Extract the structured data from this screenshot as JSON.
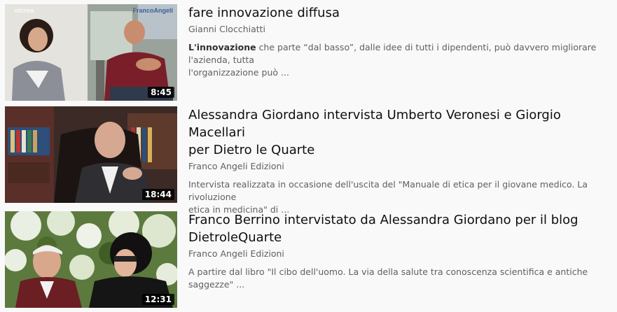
{
  "videos": [
    {
      "title_lines": [
        "fare innovazione diffusa"
      ],
      "channel": "Gianni Clocchiatti",
      "desc_bold": "L'innovazione",
      "desc_rest_line1": " che parte “dal basso”, dalle idee di tutti i dipendenti, può davvero migliorare l'azienda, tutta",
      "desc_line2": "l'organizzazione può ...",
      "duration": "8:45",
      "watermark_left": "eticrea",
      "watermark_right": "FrancoAngeli"
    },
    {
      "title_lines": [
        "Alessandra Giordano intervista Umberto Veronesi e Giorgio Macellari",
        "per Dietro le Quarte"
      ],
      "channel": "Franco Angeli Edizioni",
      "desc_line1": "Intervista realizzata in occasione dell'uscita del \"Manuale di etica per il giovane medico. La rivoluzione",
      "desc_line2": "etica in medicina\" di ...",
      "duration": "18:44"
    },
    {
      "title_lines": [
        "Franco Berrino intervistato da Alessandra Giordano per il blog",
        "DietroleQuarte"
      ],
      "channel": "Franco Angeli Edizioni",
      "desc_line1": "A partire dal libro \"Il cibo dell'uomo. La via della salute tra conoscenza scientifica e antiche saggezze\" ...",
      "duration": "12:31"
    }
  ]
}
